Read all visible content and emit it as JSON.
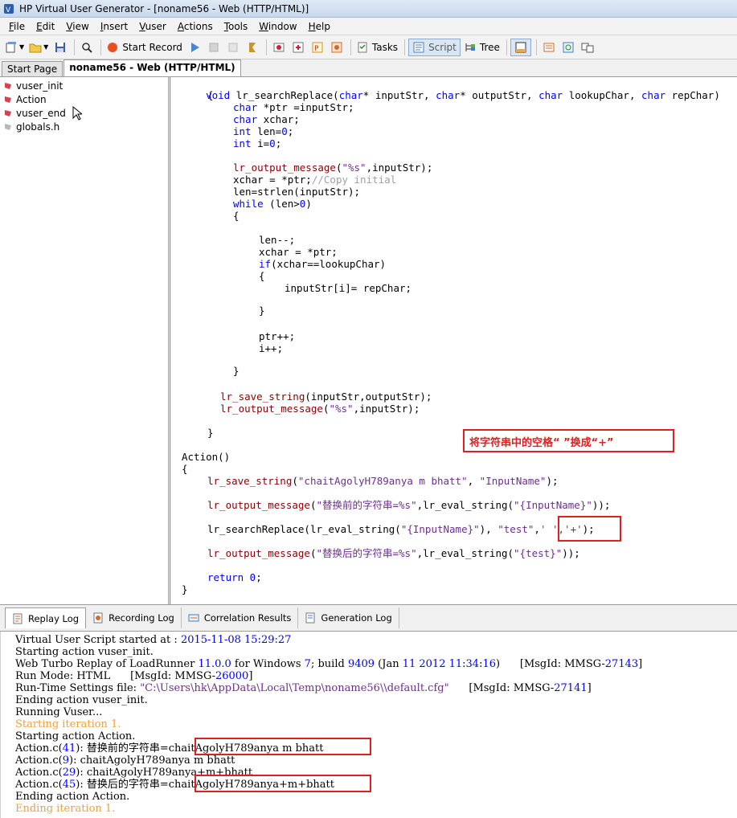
{
  "window": {
    "title": "HP Virtual User Generator - [noname56 - Web (HTTP/HTML)]"
  },
  "menu": [
    {
      "label": "File",
      "u": "F",
      "rest": "ile"
    },
    {
      "label": "Edit",
      "u": "E",
      "rest": "dit"
    },
    {
      "label": "View",
      "u": "V",
      "rest": "iew"
    },
    {
      "label": "Insert",
      "u": "I",
      "rest": "nsert"
    },
    {
      "label": "Vuser",
      "u": "V",
      "rest": "user"
    },
    {
      "label": "Actions",
      "u": "A",
      "rest": "ctions"
    },
    {
      "label": "Tools",
      "u": "T",
      "rest": "ools"
    },
    {
      "label": "Window",
      "u": "W",
      "rest": "indow"
    },
    {
      "label": "Help",
      "u": "H",
      "rest": "elp"
    }
  ],
  "toolbar": {
    "start_record": "Start Record",
    "tasks": "Tasks",
    "script": "Script",
    "tree": "Tree"
  },
  "doc_tabs": [
    "Start Page",
    "noname56 - Web (HTTP/HTML)"
  ],
  "tree_items": [
    "vuser_init",
    "Action",
    "vuser_end",
    "globals.h"
  ],
  "code": {
    "fn_sig_void": "void",
    "fn_sig_name": " lr_searchReplace(",
    "fn_sig_char1": "char",
    "fn_sig_p1": "* inputStr, ",
    "fn_sig_char2": "char",
    "fn_sig_p2": "* outputStr, ",
    "fn_sig_char3": "char",
    "fn_sig_p3": " lookupChar, ",
    "fn_sig_char4": "char",
    "fn_sig_p4": " repChar)",
    "l_open": "{",
    "l_ptr_kw": "char",
    "l_ptr_rest": " *ptr =inputStr;",
    "l_xchar_kw": "char",
    "l_xchar_rest": " xchar;",
    "l_len_kw": "int",
    "l_len_rest": " len=",
    "l_len_num": "0",
    "l_len_end": ";",
    "l_i_kw": "int",
    "l_i_rest": " i=",
    "l_i_num": "0",
    "l_i_end": ";",
    "l_out_fn": "lr_output_message",
    "l_out_mid": "(",
    "l_out_str": "\"%s\"",
    "l_out_end": ",inputStr);",
    "l_xc": "xchar = *ptr;",
    "l_xc_cmt": "//Copy initial",
    "l_strlen": "len=strlen(inputStr);",
    "l_while_kw": "while",
    "l_while_rest": " (len>",
    "l_while_num": "0",
    "l_while_end": ")",
    "l_brace1": "{",
    "l_lenmm": "len--;",
    "l_xc2": "xchar = *ptr;",
    "l_if_kw": "if",
    "l_if_rest": "(xchar==lookupChar)",
    "l_brace2": "{",
    "l_assign": "inputStr[i]= repChar;",
    "l_close2": "}",
    "l_ptrpp": "ptr++;",
    "l_ipp": "i++;",
    "l_close1": "}",
    "l_save_fn": "lr_save_string",
    "l_save_rest": "(inputStr,outputStr);",
    "l_out2_fn": "lr_output_message",
    "l_out2_mid": "(",
    "l_out2_str": "\"%s\"",
    "l_out2_end": ",inputStr);",
    "l_close_fn": "}",
    "a_sig": "Action()",
    "a_open": "{",
    "a_save_fn": "lr_save_string",
    "a_save_mid": "(",
    "a_save_str1": "\"chaitAgolyH789anya m bhatt\"",
    "a_save_comma": ", ",
    "a_save_str2": "\"InputName\"",
    "a_save_end": ");",
    "a_out1_fn": "lr_output_message",
    "a_out1_mid": "(",
    "a_out1_str": "\"替换前的字符串=%s\"",
    "a_out1_c": ",",
    "a_out1_fn2": "lr_eval_string",
    "a_out1_p": "(",
    "a_out1_str2": "\"{InputName}\"",
    "a_out1_end": "));",
    "a_sr_fn": "lr_searchReplace(",
    "a_sr_fn2": "lr_eval_string",
    "a_sr_p": "(",
    "a_sr_str1": "\"{InputName}\"",
    "a_sr_c1": "), ",
    "a_sr_str2": "\"test\"",
    "a_sr_c2": ",",
    "a_sr_chars": "' ','+'",
    "a_sr_end": ");",
    "a_out2_fn": "lr_output_message",
    "a_out2_mid": "(",
    "a_out2_str": "\"替换后的字符串=%s\"",
    "a_out2_c": ",",
    "a_out2_fn2": "lr_eval_string",
    "a_out2_p": "(",
    "a_out2_str2": "\"{test}\"",
    "a_out2_end": "));",
    "a_ret_kw": "return",
    "a_ret_num": " 0",
    "a_ret_end": ";",
    "a_close": "}"
  },
  "annotation": "将字符串中的空格“ ”换成“+”",
  "bottom_tabs": [
    "Replay Log",
    "Recording Log",
    "Correlation Results",
    "Generation Log"
  ],
  "log": {
    "l1a": "Virtual User Script started at : ",
    "l1b": "2015-11-08 15:29:27",
    "l2": "Starting action vuser_init.",
    "l3a": "Web Turbo Replay of LoadRunner ",
    "l3b": "11.0.0",
    "l3c": " for Windows ",
    "l3d": "7",
    "l3e": "; build ",
    "l3f": "9409",
    "l3g": " (Jan ",
    "l3h": "11 2012 11",
    "l3i": ":",
    "l3j": "34",
    "l3k": ":",
    "l3l": "16",
    "l3m": ")      [MsgId: MMSG-",
    "l3n": "27143",
    "l3o": "]",
    "l4a": "Run Mode: HTML      [MsgId: MMSG-",
    "l4b": "26000",
    "l4c": "]",
    "l5a": "Run-Time Settings file: ",
    "l5b": "\"C:\\Users\\hk\\AppData\\Local\\Temp\\noname56\\\\default.cfg\"",
    "l5c": "      [MsgId: MMSG-",
    "l5d": "27141",
    "l5e": "]",
    "l6": "Ending action vuser_init.",
    "l7": "Running Vuser...",
    "l8": "Starting iteration 1.",
    "l9": "Starting action Action.",
    "l10a": "Action.c(",
    "l10b": "41",
    "l10c": "): 替换前的字符串=",
    "l10d": "chaitAgolyH789anya m bhatt",
    "l11a": "Action.c(",
    "l11b": "9",
    "l11c": "): chaitAgolyH789anya m bhatt",
    "l12a": "Action.c(",
    "l12b": "29",
    "l12c": "): chaitAgolyH789anya+m+bhatt",
    "l13a": "Action.c(",
    "l13b": "45",
    "l13c": "): 替换后的字符串=",
    "l13d": "chaitAgolyH789anya+m+bhatt",
    "l14": "Ending action Action.",
    "l15": "Ending iteration 1."
  }
}
